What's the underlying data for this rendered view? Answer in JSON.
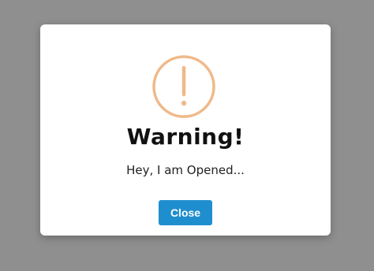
{
  "dialog": {
    "title": "Warning!",
    "message": "Hey, I am Opened...",
    "icon": "warning-circle-icon",
    "close_label": "Close"
  },
  "colors": {
    "overlay": "#8f8f8f",
    "dialog_background": "#ffffff",
    "icon": "#f0b98a",
    "button": "#1f8ecf",
    "button_text": "#ffffff"
  }
}
